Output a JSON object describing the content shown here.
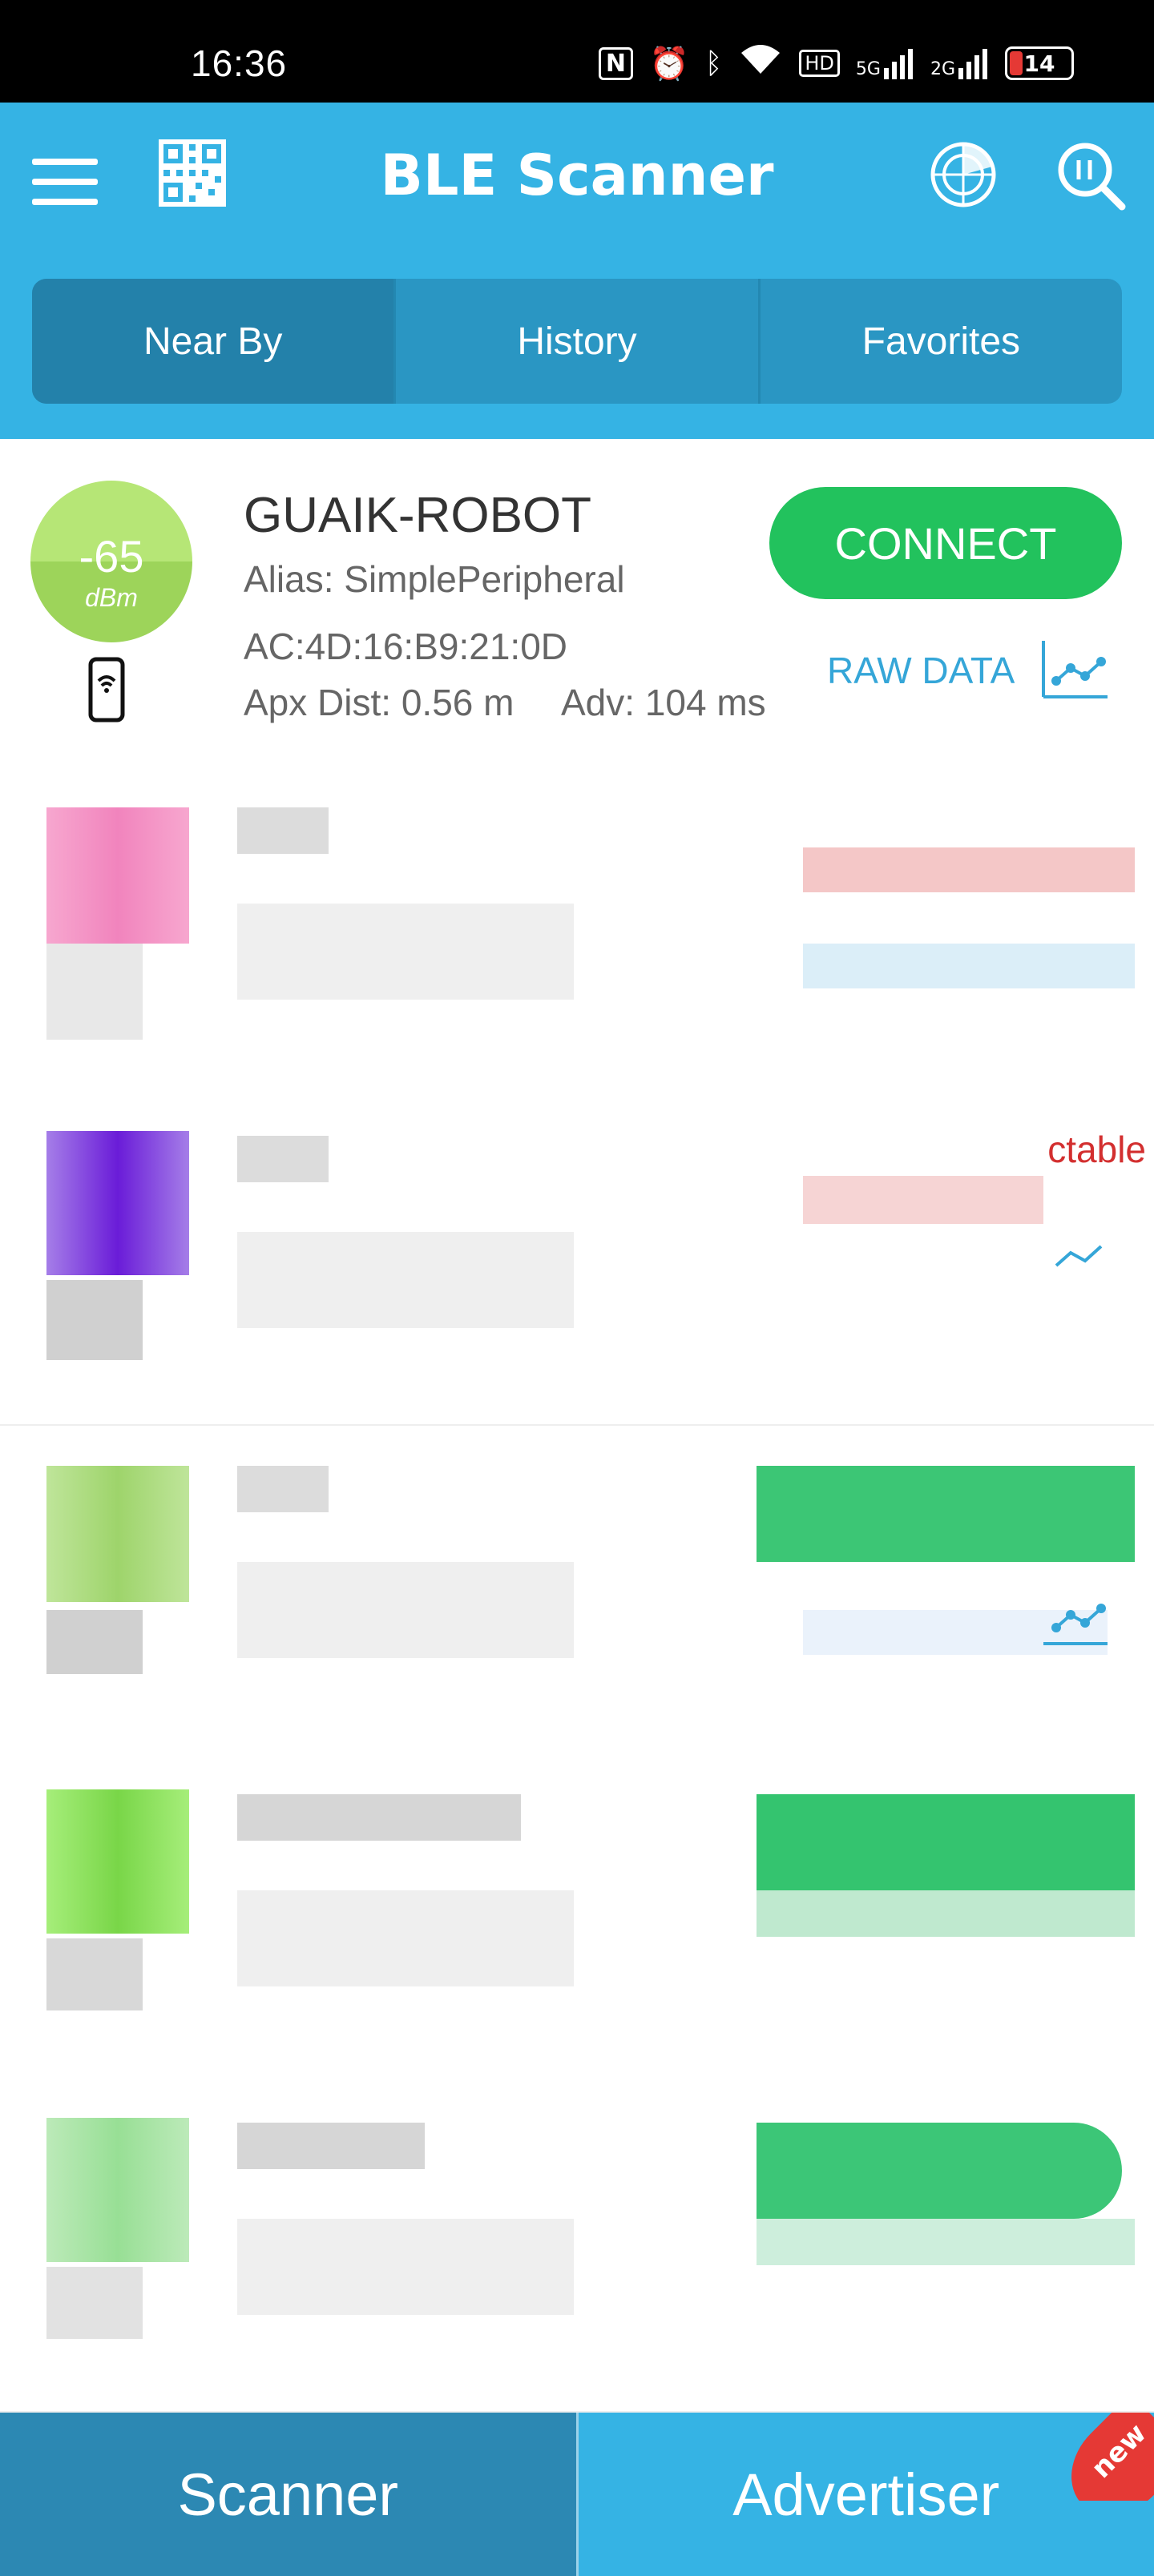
{
  "status_bar": {
    "time": "16:36",
    "nfc": "N",
    "network_hd": "HD",
    "network_5g": "5G",
    "network_2g": "2G",
    "battery": "14"
  },
  "header": {
    "title": "BLE Scanner",
    "tabs": [
      "Near By",
      "History",
      "Favorites"
    ],
    "active_tab": "Near By"
  },
  "devices": [
    {
      "rssi": "-65",
      "rssi_unit": "dBm",
      "name": "GUAIK-ROBOT",
      "alias": "Alias: SimplePeripheral",
      "mac": "AC:4D:16:B9:21:0D",
      "distance": "Apx Dist: 0.56 m",
      "interval": "Adv: 104 ms",
      "connect_label": "CONNECT",
      "raw_data_label": "RAW DATA"
    }
  ],
  "obscured_rows": [
    {
      "visible_text": "ctable"
    }
  ],
  "bottom_nav": {
    "scanner": "Scanner",
    "advertiser": "Advertiser",
    "new_badge": "new"
  },
  "colors": {
    "header_blue": "#35b3e4",
    "connect_green": "#22c25d",
    "rssi_green": "#b6e676",
    "link_blue": "#35a6d8",
    "alert_red": "#d32f2f"
  }
}
